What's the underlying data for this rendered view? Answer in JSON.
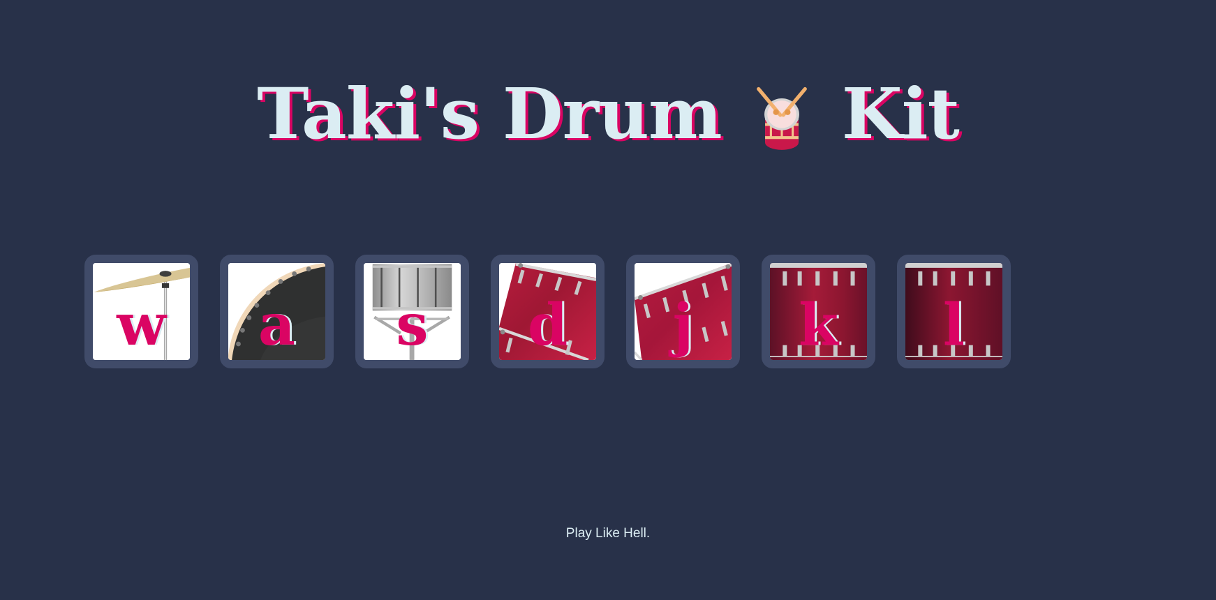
{
  "title": {
    "before_icon": "Taki's Drum",
    "icon": "drum-with-drumsticks-emoji",
    "after_icon": "Kit"
  },
  "drums": [
    {
      "key": "w",
      "sound": "crash",
      "art": "crash-cymbal-icon"
    },
    {
      "key": "a",
      "sound": "kick-bass",
      "art": "kick-drum-icon"
    },
    {
      "key": "s",
      "sound": "snare",
      "art": "snare-drum-icon"
    },
    {
      "key": "d",
      "sound": "tom-1",
      "art": "tom-drum-icon"
    },
    {
      "key": "j",
      "sound": "tom-2",
      "art": "tom-drum-icon"
    },
    {
      "key": "k",
      "sound": "tom-3",
      "art": "floor-tom-icon"
    },
    {
      "key": "l",
      "sound": "tom-4",
      "art": "floor-tom-icon"
    }
  ],
  "footer": {
    "text": "Play Like Hell."
  },
  "colors": {
    "background": "#283149",
    "button_border": "#404b69",
    "accent": "#da0463",
    "text_light": "#dbedf3"
  }
}
